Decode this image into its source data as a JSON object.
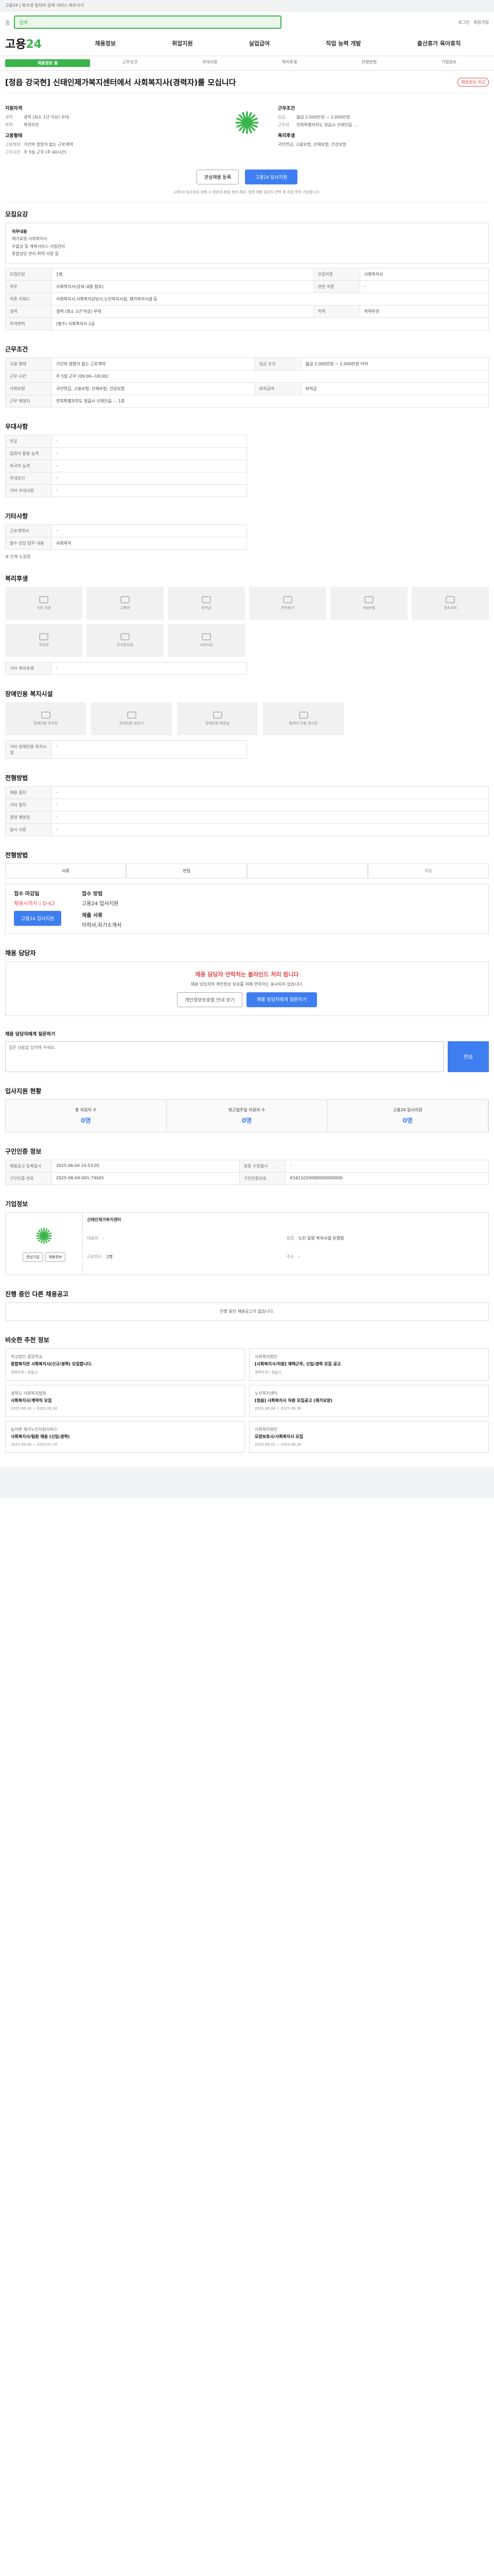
{
  "topbar": "고용24 | 워크넷 일자리 검색 서비스 바로가기",
  "search": {
    "home": "홈",
    "placeholder": "검색",
    "links": [
      "로그인",
      "회원가입"
    ]
  },
  "brand": {
    "logo": "고용",
    "logo2": "24",
    "nav": [
      "채용정보",
      "취업지원",
      "실업급여",
      "직업 능력 개발",
      "출산휴가 육아휴직"
    ]
  },
  "subnav": [
    "채용정보 홈",
    "근무조건",
    "우대사항",
    "복리후생",
    "전형방법",
    "기업정보"
  ],
  "job": {
    "title": "[정읍 강국현] 신태인제가복지센터에서 사회복지사(경력자)를 모십니다",
    "badge": "채용정보 마감",
    "recruit_h": "지원자격",
    "recruit": [
      [
        "경력",
        "경력 (최소 1년 이상) 우대"
      ],
      [
        "학력",
        "학력무관"
      ]
    ],
    "cond_h": "근무조건",
    "cond": [
      [
        "임금",
        "월급 2,000만원 ~ 2,000만원"
      ],
      [
        "근무지",
        "전북특별자치도 정읍시 신태인읍 ..."
      ]
    ],
    "type_h": "고용형태",
    "type": [
      [
        "고용형태",
        "기간의 정함이 없는 근로계약"
      ],
      [
        "근무시간",
        "주 5일 근무 (주 40시간)"
      ]
    ],
    "welfare_h": "복리후생",
    "welfare": "국민연금, 고용보험, 산재보험, 건강보험",
    "scrap": "관심채용 등록",
    "apply": "고용24 입사지원",
    "note": "고용24 입사지원 대행 시 원본과 동일 정보 제공, 업체 채용 담당자 연락 후 지원 문의 가능합니다."
  },
  "sec_summary": {
    "h": "모집요강",
    "sub": "직무내용",
    "items": [
      "재가요양 사회복지사",
      "우울성 및 계획서비스 사업관리",
      "종합상담 관리 취약 사항 등"
    ]
  },
  "rows1": [
    [
      "모집인원",
      "1명",
      "모집직종",
      "사회복지사"
    ],
    [
      "직무",
      "사회복지사(상세 내용 참조)",
      "관련 직종",
      "-"
    ],
    [
      "직종 키워드",
      "사회복지사,사회복지상담사,노인복지시설, 재가복지시설 등",
      "",
      ""
    ],
    [
      "경력",
      "경력 (최소 1년 이상) 우대",
      "학력",
      "학력무관"
    ],
    [
      "자격면허",
      "(필수) 사회복지사 2급",
      "",
      ""
    ]
  ],
  "sec_cond": {
    "h": "근무조건"
  },
  "rows2": [
    [
      "고용 형태",
      "기간의 정함이 없는 근로계약",
      "임금 조건",
      "월급 2,000만원 ~ 2,000만원 이하"
    ],
    [
      "근무 시간",
      "주 5일 근무 (09:00~18:00)",
      "",
      ""
    ],
    [
      "사회보험",
      "국민연금, 고용보험, 산재보험, 건강보험",
      "퇴직급여",
      "퇴직금"
    ],
    [
      "근무 예정지",
      "전북특별자치도 정읍시 신태인읍 ... 1층",
      "",
      ""
    ]
  ],
  "sec_pref": {
    "h": "우대사항",
    "rows": [
      [
        "전공",
        "-"
      ],
      [
        "컴퓨터 활용 능력",
        "-"
      ],
      [
        "외국어 능력",
        "-"
      ],
      [
        "우대조건",
        "-"
      ],
      [
        "기타 우대사항",
        "-"
      ]
    ]
  },
  "sec_extra": {
    "h": "기타사항",
    "rows": [
      [
        "근로계약서",
        "-"
      ],
      [
        "필수 담당 업무 내용",
        "사회복지"
      ]
    ],
    "tool": "표 인쇄 도움말"
  },
  "sec_welfare": {
    "h": "복리후생",
    "items": [
      "식비 지원",
      "교통비",
      "퇴직금",
      "연차휴가",
      "4대보험",
      "경조사비",
      "주차장",
      "주차장지원",
      "사내식당"
    ],
    "more_h": "기타 복리후생",
    "more": "-"
  },
  "sec_disabled": {
    "h": "장애인용 복지시설",
    "items": [
      "장애인용 주차장",
      "장애인용 승강기",
      "장애인용 화장실",
      "휠체어 전용 경사로"
    ],
    "more_h": "기타 장애인용 복지시설",
    "more": "-"
  },
  "sec_proc": {
    "h": "전형방법",
    "rows": [
      [
        "채용 절차",
        "-"
      ],
      [
        "기타 절차",
        "-"
      ],
      [
        "결정 예정일",
        "-"
      ],
      [
        "응시 서류",
        "-"
      ]
    ]
  },
  "sec_apply": {
    "h": "전형방법",
    "methods": [
      "서류",
      "면접",
      "",
      "채용"
    ],
    "deadline_k": "접수 마감일",
    "deadline": "채용시까지 | D-62",
    "apply_k": "접수 방법",
    "apply": "고용24 입사지원",
    "sub_k": "제출 서류",
    "sub": "이력서,자기소개서",
    "btn": "고용24 입사지원"
  },
  "sec_contact": {
    "h": "채용 담당자",
    "title": "채용 담당자 연락처는 블라인드 처리 됩니다",
    "desc": "채용 담당자의 개인정보 보호를 위해 연락처는 표시되지 않습니다.",
    "b1": "개인정보보호법 안내 보기",
    "b2": "채용 담당자에게 질문하기"
  },
  "sec_qa": {
    "h": "채용 담당자에게 질문하기",
    "placeholder": "질문 내용을 입력해 주세요.",
    "btn": "전송"
  },
  "sec_stat": {
    "h": "입사지원 현황",
    "items": [
      [
        "총 지원자 수",
        "0명"
      ],
      [
        "최근일주일 지원자 수",
        "0명"
      ],
      [
        "고용24 입사지원",
        "0명"
      ]
    ]
  },
  "sec_info": {
    "h": "구인인증 정보",
    "rows": [
      [
        "채용공고 등록일시",
        "2025.06.04 14:53:05",
        "최종 수정일시",
        "-"
      ],
      [
        "구인인증 번호",
        "2025-06-04-001-74045",
        "구인인증번호",
        "K1611020000000000000"
      ]
    ]
  },
  "sec_corp": {
    "h": "기업정보",
    "name": "신태인재가복지센터",
    "rows": [
      [
        "대표자",
        "-"
      ],
      [
        "업종",
        "노인 요양 복지시설 운영업"
      ],
      [
        "근로자수",
        "2명"
      ],
      [
        "주소",
        "-"
      ]
    ],
    "b1": "관심기업",
    "b2": "채용정보"
  },
  "sec_other": {
    "h": "진행 중인 다른 채용공고",
    "none": "진행 중인 채용공고가 없습니다."
  },
  "sec_similar": {
    "h": "비슷한 추천 정보",
    "cards": [
      {
        "co": "학교법인 중앙학교",
        "ti": "종합복지관 사회복지사(신규/경력) 모집합니다.",
        "d": "경력무관 | 정읍시"
      },
      {
        "co": "사회복지법인",
        "ti": "[사회복지사/직원] 재택근무, 신입/경력 모집 공고",
        "d": "경력무관 | 정읍시"
      },
      {
        "co": "경북도 사회복지협회",
        "ti": "사회복지사/계약직 모집",
        "d": "2025.06.10 ~ 2025.06.30"
      },
      {
        "co": "노인복지센터",
        "ti": "[정읍] 사회복지사 직원 모집공고 (재가요양)",
        "d": "2025.06.04 ~ 2025.06.30"
      },
      {
        "co": "농어촌 재가노인지원서비스",
        "ti": "사회복지사/팀원 채용 (신입/경력)",
        "d": "2025.06.09 ~ 2025.07.20"
      },
      {
        "co": "사회복지법인",
        "ti": "요양보호사/사회복지사 모집",
        "d": "2025.06.01 ~ 2025.06.30"
      }
    ]
  }
}
